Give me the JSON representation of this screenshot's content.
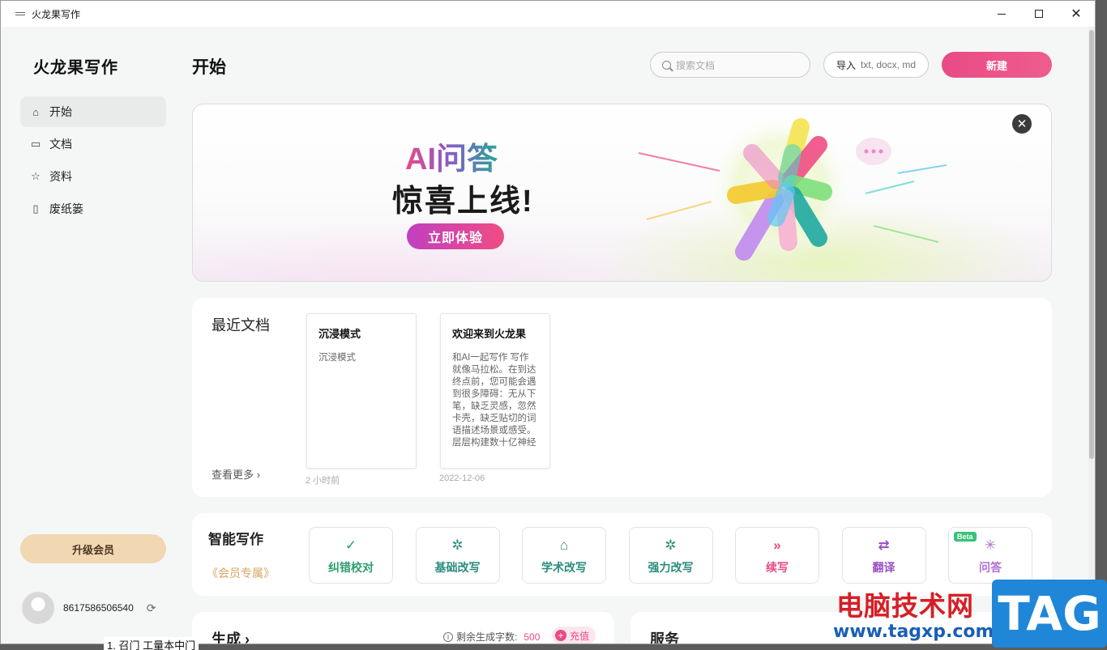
{
  "window": {
    "title": "火龙果写作"
  },
  "sidebar": {
    "logo_text": "火龙果写作",
    "items": [
      {
        "label": "开始",
        "icon": "home-icon",
        "active": true
      },
      {
        "label": "文档",
        "icon": "document-icon",
        "active": false
      },
      {
        "label": "资料",
        "icon": "star-icon",
        "active": false
      },
      {
        "label": "废纸篓",
        "icon": "trash-icon",
        "active": false
      }
    ],
    "upgrade_label": "升级会员",
    "user_phone": "8617586506540"
  },
  "header": {
    "title": "开始",
    "search_placeholder": "搜索文档",
    "import_label": "导入",
    "import_hint": "txt, docx, md",
    "new_label": "新建"
  },
  "banner": {
    "headline": "AI问答",
    "subline": "惊喜上线!",
    "cta_label": "立即体验"
  },
  "recent": {
    "title": "最近文档",
    "more_label": "查看更多",
    "docs": [
      {
        "title": "沉浸模式",
        "preview": "沉浸模式",
        "date": "2 小时前"
      },
      {
        "title": "欢迎来到火龙果",
        "preview": "和AI一起写作 写作就像马拉松。在到达终点前，您可能会遇到很多障碍：无从下笔，缺乏灵感，忽然卡壳，缺乏贴切的词语描述场景或感受。 层层构建数十亿神经",
        "date": "2022-12-06"
      }
    ]
  },
  "smart": {
    "title": "智能写作",
    "member_label": "《会员专属》",
    "tools": [
      {
        "label": "纠错校对",
        "icon": "check-icon",
        "glyph": "✓",
        "color": "#2e9e6e"
      },
      {
        "label": "基础改写",
        "icon": "magic-wand-icon",
        "glyph": "✲",
        "color": "#2a8c7c"
      },
      {
        "label": "学术改写",
        "icon": "graduation-cap-icon",
        "glyph": "⌂",
        "color": "#2a8c7c"
      },
      {
        "label": "强力改写",
        "icon": "sparkle-wand-icon",
        "glyph": "✲",
        "color": "#2a8c7c"
      },
      {
        "label": "续写",
        "icon": "double-chevron-icon",
        "glyph": "»",
        "color": "#e94a85"
      },
      {
        "label": "翻译",
        "icon": "swap-icon",
        "glyph": "⇄",
        "color": "#9b4fc7"
      },
      {
        "label": "问答",
        "icon": "ai-qa-icon",
        "glyph": "✳",
        "color": "#b06fd0",
        "badge": "Beta"
      }
    ]
  },
  "generate": {
    "title": "生成",
    "quota_label": "剩余生成字数:",
    "quota_value": "500",
    "recharge_label": "充值"
  },
  "service": {
    "title": "服务"
  },
  "watermark": {
    "cn": "电脑技术网",
    "url": "www.tagxp.com",
    "tag": "TAG"
  },
  "behind_text": "1. 召门 工量本中门"
}
